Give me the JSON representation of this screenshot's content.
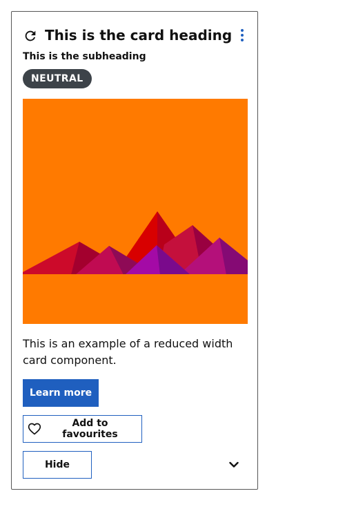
{
  "card": {
    "heading": "This is the card heading",
    "subheading": "This is the subheading",
    "badge": "NEUTRAL",
    "body": "This is an example of a reduced width card component.",
    "actions": {
      "primary": "Learn more",
      "favourite": "Add to favourites",
      "hide": "Hide"
    },
    "icons": {
      "header": "refresh-icon",
      "menu": "more-vertical-icon",
      "favourite": "heart-outline-icon",
      "expand": "chevron-down-icon"
    }
  },
  "colors": {
    "accent": "#1f5fbf",
    "badge_bg": "#3d4349",
    "image_bg": "#ff7a00"
  }
}
